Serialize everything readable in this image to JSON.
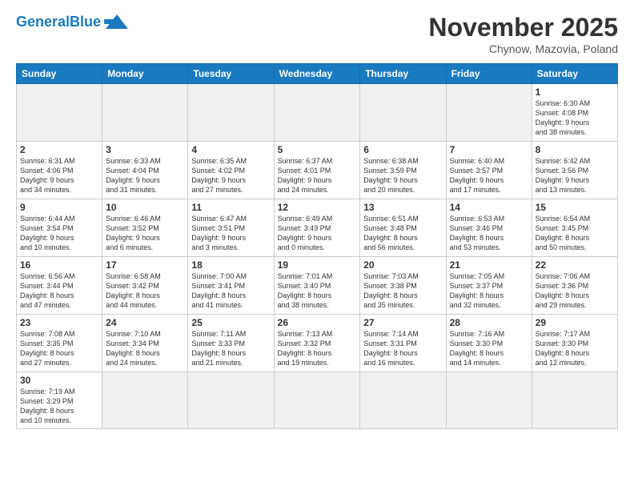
{
  "header": {
    "logo_general": "General",
    "logo_blue": "Blue",
    "month_title": "November 2025",
    "subtitle": "Chynow, Mazovia, Poland"
  },
  "weekdays": [
    "Sunday",
    "Monday",
    "Tuesday",
    "Wednesday",
    "Thursday",
    "Friday",
    "Saturday"
  ],
  "weeks": [
    [
      {
        "day": "",
        "info": "",
        "empty": true
      },
      {
        "day": "",
        "info": "",
        "empty": true
      },
      {
        "day": "",
        "info": "",
        "empty": true
      },
      {
        "day": "",
        "info": "",
        "empty": true
      },
      {
        "day": "",
        "info": "",
        "empty": true
      },
      {
        "day": "",
        "info": "",
        "empty": true
      },
      {
        "day": "1",
        "info": "Sunrise: 6:30 AM\nSunset: 4:08 PM\nDaylight: 9 hours\nand 38 minutes.",
        "empty": false
      }
    ],
    [
      {
        "day": "2",
        "info": "Sunrise: 6:31 AM\nSunset: 4:06 PM\nDaylight: 9 hours\nand 34 minutes.",
        "empty": false
      },
      {
        "day": "3",
        "info": "Sunrise: 6:33 AM\nSunset: 4:04 PM\nDaylight: 9 hours\nand 31 minutes.",
        "empty": false
      },
      {
        "day": "4",
        "info": "Sunrise: 6:35 AM\nSunset: 4:02 PM\nDaylight: 9 hours\nand 27 minutes.",
        "empty": false
      },
      {
        "day": "5",
        "info": "Sunrise: 6:37 AM\nSunset: 4:01 PM\nDaylight: 9 hours\nand 24 minutes.",
        "empty": false
      },
      {
        "day": "6",
        "info": "Sunrise: 6:38 AM\nSunset: 3:59 PM\nDaylight: 9 hours\nand 20 minutes.",
        "empty": false
      },
      {
        "day": "7",
        "info": "Sunrise: 6:40 AM\nSunset: 3:57 PM\nDaylight: 9 hours\nand 17 minutes.",
        "empty": false
      },
      {
        "day": "8",
        "info": "Sunrise: 6:42 AM\nSunset: 3:56 PM\nDaylight: 9 hours\nand 13 minutes.",
        "empty": false
      }
    ],
    [
      {
        "day": "9",
        "info": "Sunrise: 6:44 AM\nSunset: 3:54 PM\nDaylight: 9 hours\nand 10 minutes.",
        "empty": false
      },
      {
        "day": "10",
        "info": "Sunrise: 6:46 AM\nSunset: 3:52 PM\nDaylight: 9 hours\nand 6 minutes.",
        "empty": false
      },
      {
        "day": "11",
        "info": "Sunrise: 6:47 AM\nSunset: 3:51 PM\nDaylight: 9 hours\nand 3 minutes.",
        "empty": false
      },
      {
        "day": "12",
        "info": "Sunrise: 6:49 AM\nSunset: 3:49 PM\nDaylight: 9 hours\nand 0 minutes.",
        "empty": false
      },
      {
        "day": "13",
        "info": "Sunrise: 6:51 AM\nSunset: 3:48 PM\nDaylight: 8 hours\nand 56 minutes.",
        "empty": false
      },
      {
        "day": "14",
        "info": "Sunrise: 6:53 AM\nSunset: 3:46 PM\nDaylight: 8 hours\nand 53 minutes.",
        "empty": false
      },
      {
        "day": "15",
        "info": "Sunrise: 6:54 AM\nSunset: 3:45 PM\nDaylight: 8 hours\nand 50 minutes.",
        "empty": false
      }
    ],
    [
      {
        "day": "16",
        "info": "Sunrise: 6:56 AM\nSunset: 3:44 PM\nDaylight: 8 hours\nand 47 minutes.",
        "empty": false
      },
      {
        "day": "17",
        "info": "Sunrise: 6:58 AM\nSunset: 3:42 PM\nDaylight: 8 hours\nand 44 minutes.",
        "empty": false
      },
      {
        "day": "18",
        "info": "Sunrise: 7:00 AM\nSunset: 3:41 PM\nDaylight: 8 hours\nand 41 minutes.",
        "empty": false
      },
      {
        "day": "19",
        "info": "Sunrise: 7:01 AM\nSunset: 3:40 PM\nDaylight: 8 hours\nand 38 minutes.",
        "empty": false
      },
      {
        "day": "20",
        "info": "Sunrise: 7:03 AM\nSunset: 3:38 PM\nDaylight: 8 hours\nand 35 minutes.",
        "empty": false
      },
      {
        "day": "21",
        "info": "Sunrise: 7:05 AM\nSunset: 3:37 PM\nDaylight: 8 hours\nand 32 minutes.",
        "empty": false
      },
      {
        "day": "22",
        "info": "Sunrise: 7:06 AM\nSunset: 3:36 PM\nDaylight: 8 hours\nand 29 minutes.",
        "empty": false
      }
    ],
    [
      {
        "day": "23",
        "info": "Sunrise: 7:08 AM\nSunset: 3:35 PM\nDaylight: 8 hours\nand 27 minutes.",
        "empty": false
      },
      {
        "day": "24",
        "info": "Sunrise: 7:10 AM\nSunset: 3:34 PM\nDaylight: 8 hours\nand 24 minutes.",
        "empty": false
      },
      {
        "day": "25",
        "info": "Sunrise: 7:11 AM\nSunset: 3:33 PM\nDaylight: 8 hours\nand 21 minutes.",
        "empty": false
      },
      {
        "day": "26",
        "info": "Sunrise: 7:13 AM\nSunset: 3:32 PM\nDaylight: 8 hours\nand 19 minutes.",
        "empty": false
      },
      {
        "day": "27",
        "info": "Sunrise: 7:14 AM\nSunset: 3:31 PM\nDaylight: 8 hours\nand 16 minutes.",
        "empty": false
      },
      {
        "day": "28",
        "info": "Sunrise: 7:16 AM\nSunset: 3:30 PM\nDaylight: 8 hours\nand 14 minutes.",
        "empty": false
      },
      {
        "day": "29",
        "info": "Sunrise: 7:17 AM\nSunset: 3:30 PM\nDaylight: 8 hours\nand 12 minutes.",
        "empty": false
      }
    ],
    [
      {
        "day": "30",
        "info": "Sunrise: 7:19 AM\nSunset: 3:29 PM\nDaylight: 8 hours\nand 10 minutes.",
        "empty": false
      },
      {
        "day": "",
        "info": "",
        "empty": true
      },
      {
        "day": "",
        "info": "",
        "empty": true
      },
      {
        "day": "",
        "info": "",
        "empty": true
      },
      {
        "day": "",
        "info": "",
        "empty": true
      },
      {
        "day": "",
        "info": "",
        "empty": true
      },
      {
        "day": "",
        "info": "",
        "empty": true
      }
    ]
  ]
}
